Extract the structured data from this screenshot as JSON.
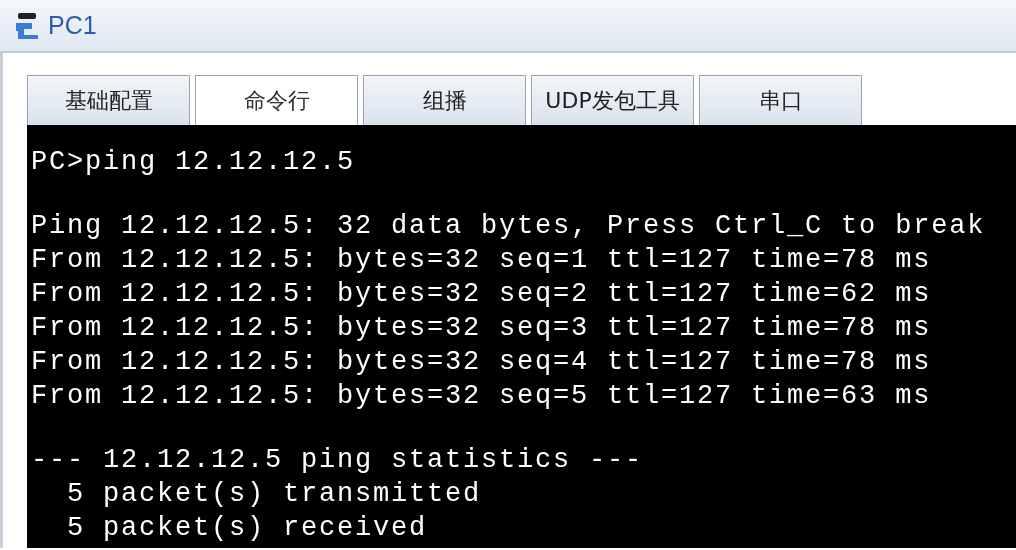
{
  "window": {
    "title": "PC1"
  },
  "tabs": [
    {
      "label": "基础配置",
      "selected": false
    },
    {
      "label": "命令行",
      "selected": true
    },
    {
      "label": "组播",
      "selected": false
    },
    {
      "label": "UDP发包工具",
      "selected": false
    },
    {
      "label": "串口",
      "selected": false
    }
  ],
  "terminal": {
    "blocks": [
      [
        "PC>ping 12.12.12.5"
      ],
      [
        "Ping 12.12.12.5: 32 data bytes, Press Ctrl_C to break",
        "From 12.12.12.5: bytes=32 seq=1 ttl=127 time=78 ms",
        "From 12.12.12.5: bytes=32 seq=2 ttl=127 time=62 ms",
        "From 12.12.12.5: bytes=32 seq=3 ttl=127 time=78 ms",
        "From 12.12.12.5: bytes=32 seq=4 ttl=127 time=78 ms",
        "From 12.12.12.5: bytes=32 seq=5 ttl=127 time=63 ms"
      ],
      [
        "--- 12.12.12.5 ping statistics ---",
        "  5 packet(s) transmitted",
        "  5 packet(s) received"
      ]
    ]
  }
}
